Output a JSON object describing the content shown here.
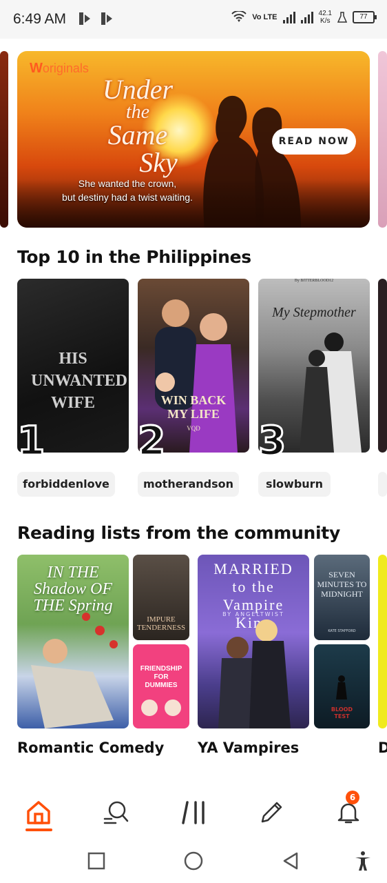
{
  "status_bar": {
    "time": "6:49 AM",
    "network": "Vo LTE",
    "speed_value": "42.1",
    "speed_unit": "K/s",
    "battery": "77"
  },
  "featured": {
    "brand_letter": "W",
    "brand_label": "originals",
    "title_line1": "Under",
    "title_line2": "the",
    "title_line3": "Same",
    "title_line4": "Sky",
    "tagline_line1": "She wanted the crown,",
    "tagline_line2": "but destiny had a twist waiting.",
    "cta_label": "READ NOW"
  },
  "top10": {
    "title": "Top 10 in the Philippines",
    "items": [
      {
        "rank": "1",
        "cover_title": "HIS UNWANTED WIFE",
        "tag": "forbiddenlove"
      },
      {
        "rank": "2",
        "cover_title": "WIN BACK MY LIFE",
        "cover_author": "VQD",
        "tag": "motherandson"
      },
      {
        "rank": "3",
        "cover_title": "My Stepmother",
        "cover_author": "By BITTERBLOOD12",
        "tag": "slowburn"
      }
    ]
  },
  "reading_lists": {
    "title": "Reading lists from the community",
    "lists": [
      {
        "name": "Romantic Comedy",
        "covers": [
          {
            "title": "IN THE Shadow OF THE Spring"
          },
          {
            "title": "IMPURE TENDERNESS"
          },
          {
            "title": "FRIENDSHIP FOR DUMMIES"
          }
        ]
      },
      {
        "name": "YA Vampires",
        "covers": [
          {
            "title": "MARRIED to the Vampire King",
            "author": "BY ANGELTWIST"
          },
          {
            "title": "SEVEN MINUTES TO MIDNIGHT",
            "author": "KATE STAFFORD"
          },
          {
            "title": "BLOOD TEST"
          }
        ]
      },
      {
        "name": "D"
      }
    ]
  },
  "bottom_nav": {
    "notification_count": "6"
  },
  "colors": {
    "accent": "#ff500a",
    "tag_bg": "#f2f2f2"
  }
}
